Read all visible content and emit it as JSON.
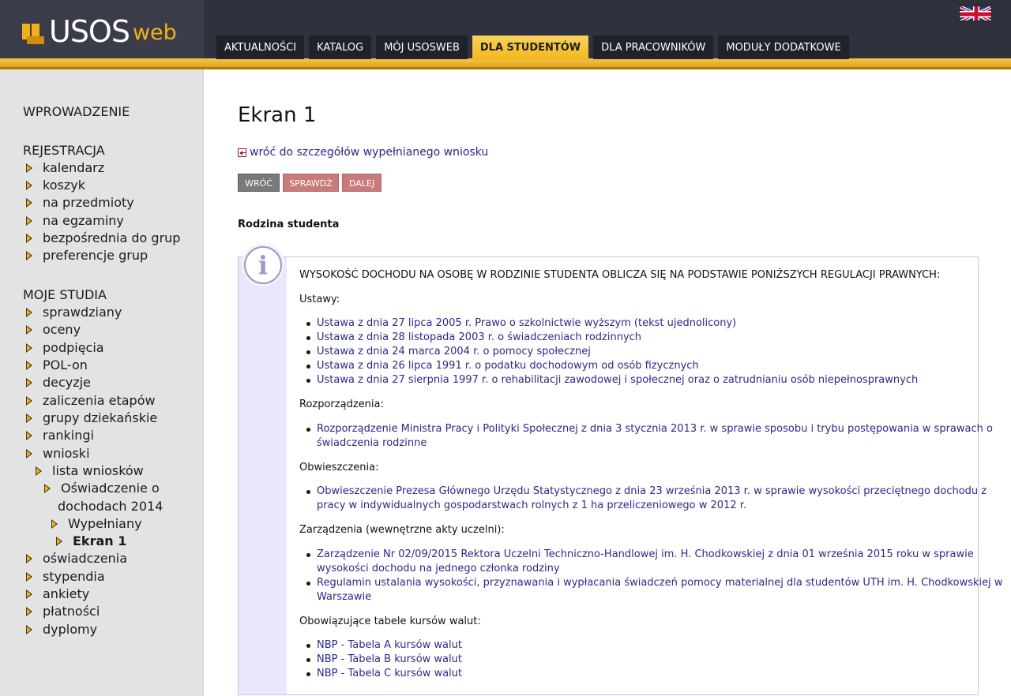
{
  "header": {
    "logo_main": "USOS",
    "logo_sub": "web",
    "language_flag": "uk-flag-icon",
    "colors": {
      "header_bg": "#2f323d",
      "accent": "#f2b11a",
      "tab_bg": "#202229"
    }
  },
  "nav": {
    "tabs": [
      {
        "label": "AKTUALNOŚCI",
        "active": false
      },
      {
        "label": "KATALOG",
        "active": false
      },
      {
        "label": "MÓJ USOSWEB",
        "active": false
      },
      {
        "label": "DLA STUDENTÓW",
        "active": true
      },
      {
        "label": "DLA PRACOWNIKÓW",
        "active": false
      },
      {
        "label": "MODUŁY DODATKOWE",
        "active": false
      }
    ]
  },
  "sidebar": {
    "intro": "WPROWADZENIE",
    "registration": {
      "title": "REJESTRACJA",
      "items": [
        "kalendarz",
        "koszyk",
        "na przedmioty",
        "na egzaminy",
        "bezpośrednia do grup",
        "preferencje grup"
      ]
    },
    "studies": {
      "title": "MOJE STUDIA",
      "items": [
        "sprawdziany",
        "oceny",
        "podpięcia",
        "POL-on",
        "decyzje",
        "zaliczenia etapów",
        "grupy dziekańskie",
        "rankingi",
        "wnioski"
      ],
      "wnioski_children": {
        "lista": "lista wniosków",
        "oswiadczenie_line1": "Oświadczenie o",
        "oswiadczenie_line2": "dochodach 2014",
        "wypelniany": "Wypełniany",
        "ekran": "Ekran 1"
      },
      "items_after": [
        "oświadczenia",
        "stypendia",
        "ankiety",
        "płatności",
        "dyplomy"
      ]
    }
  },
  "main": {
    "title": "Ekran 1",
    "back_link": "wróć do szczegółów wypełnianego wniosku",
    "buttons": {
      "back": "WRÓĆ",
      "check": "SPRAWDŹ",
      "next": "DALEJ"
    },
    "section_title": "Rodzina studenta",
    "info": {
      "heading": "WYSOKOŚĆ DOCHODU NA OSOBĘ W RODZINIE STUDENTA OBLICZA SIĘ NA PODSTAWIE PONIŻSZYCH REGULACJI PRAWNYCH:",
      "ustawy_label": "Ustawy:",
      "ustawy": [
        "Ustawa z dnia 27 lipca 2005 r. Prawo o szkolnictwie wyższym (tekst ujednolicony)",
        "Ustawa z dnia 28 listopada 2003 r. o świadczeniach rodzinnych",
        "Ustawa z dnia 24 marca 2004 r. o pomocy społecznej",
        "Ustawa z dnia 26 lipca 1991 r. o podatku dochodowym od osób fizycznych",
        "Ustawa z dnia 27 sierpnia 1997 r. o rehabilitacji zawodowej i społecznej oraz o zatrudnianiu osób niepełnosprawnych"
      ],
      "rozporzadzenia_label": "Rozporządzenia:",
      "rozporzadzenie_line1": "Rozporządzenie Ministra Pracy i Polityki Społecznej z dnia 3 stycznia 2013 r. w sprawie sposobu i trybu postępowania w sprawach o",
      "rozporzadzenie_line2": "świadczenia rodzinne",
      "obwieszczenia_label": "Obwieszczenia:",
      "obwieszczenie_line1": "Obwieszczenie Prezesa Głównego Urzędu Statystycznego z dnia 23 września 2013 r. w sprawie wysokości przeciętnego dochodu z",
      "obwieszczenie_line2": "pracy w indywidualnych gospodarstwach rolnych z 1 ha przeliczeniowego w 2012 r.",
      "zarzadzenia_label": "Zarządzenia (wewnętrzne akty uczelni):",
      "zarzadzenie1_line1": "Zarządzenie Nr 02/09/2015 Rektora Uczelni Techniczno-Handlowej im. H. Chodkowskiej z dnia 01 września 2015 roku w sprawie",
      "zarzadzenie1_line2": "wysokości dochodu na jednego członka rodziny",
      "zarzadzenie2_line1": "Regulamin ustalania wysokości, przyznawania i wypłacania świadczeń pomocy materialnej dla studentów UTH im. H. Chodkowskiej w",
      "zarzadzenie2_line2": "Warszawie",
      "tabele_label": "Obowiązujące tabele kursów walut:",
      "tabele": [
        "NBP - Tabela A kursów walut",
        "NBP - Tabela B kursów walut",
        "NBP - Tabela C kursów walut"
      ]
    }
  }
}
